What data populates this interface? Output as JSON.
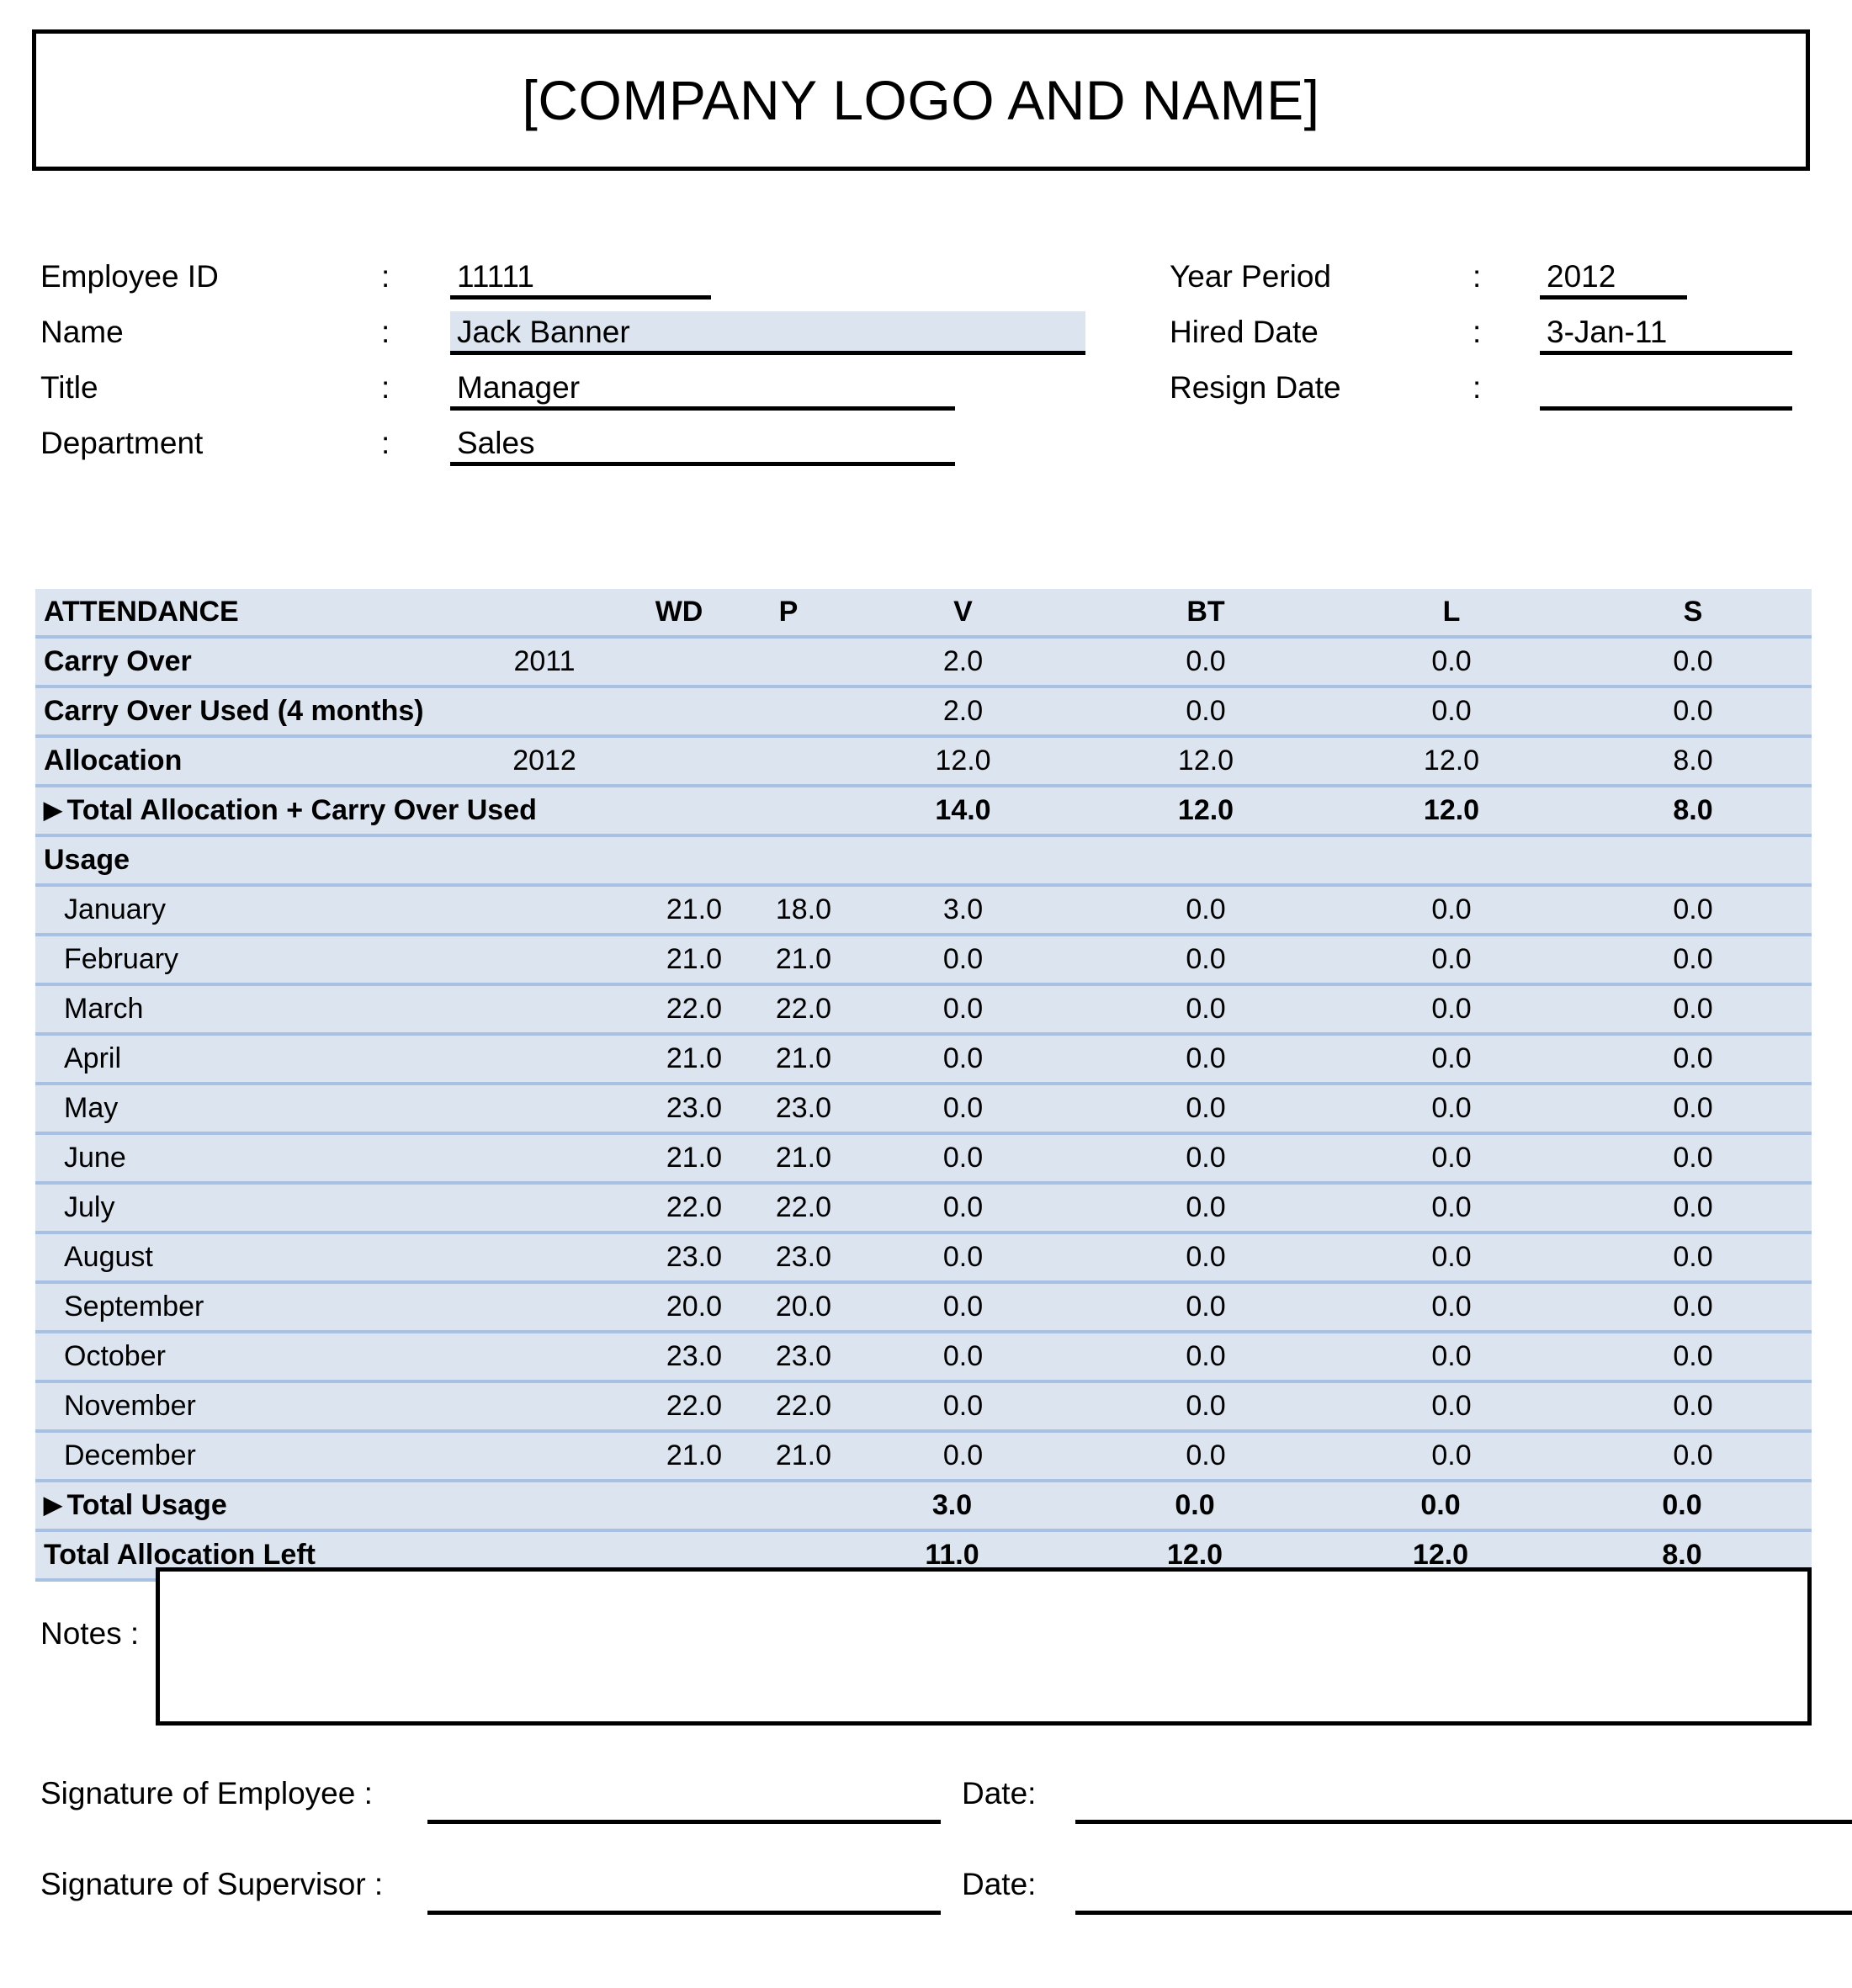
{
  "header": {
    "company_title": "[COMPANY LOGO AND NAME]"
  },
  "employee_info": {
    "colon": ":",
    "left_fields": [
      {
        "label": "Employee ID",
        "value": "11111"
      },
      {
        "label": "Name",
        "value": "Jack Banner"
      },
      {
        "label": "Title",
        "value": "Manager"
      },
      {
        "label": "Department",
        "value": "Sales"
      }
    ],
    "right_fields": [
      {
        "label": "Year Period",
        "value": "2012"
      },
      {
        "label": "Hired Date",
        "value": "3-Jan-11"
      },
      {
        "label": "Resign Date",
        "value": ""
      }
    ]
  },
  "attendance": {
    "columns": [
      "ATTENDANCE",
      "",
      "WD",
      "P",
      "V",
      "BT",
      "L",
      "S"
    ],
    "headers": {
      "label": "ATTENDANCE",
      "wd": "WD",
      "p": "P",
      "v": "V",
      "bt": "BT",
      "l": "L",
      "s": "S"
    },
    "carry_over": {
      "label": "Carry Over",
      "year": "2011",
      "wd": "",
      "p": "",
      "v": "2.0",
      "bt": "0.0",
      "l": "0.0",
      "s": "0.0"
    },
    "carry_over_used": {
      "label": "Carry Over Used (4 months)",
      "year": "",
      "wd": "",
      "p": "",
      "v": "2.0",
      "bt": "0.0",
      "l": "0.0",
      "s": "0.0"
    },
    "allocation": {
      "label": "Allocation",
      "year": "2012",
      "wd": "",
      "p": "",
      "v": "12.0",
      "bt": "12.0",
      "l": "12.0",
      "s": "8.0"
    },
    "total_allocation": {
      "marker": "▶",
      "label": "Total Allocation + Carry Over Used",
      "v": "14.0",
      "bt": "12.0",
      "l": "12.0",
      "s": "8.0"
    },
    "usage_heading": "Usage",
    "months": [
      {
        "month": "January",
        "wd": "21.0",
        "p": "18.0",
        "v": "3.0",
        "bt": "0.0",
        "l": "0.0",
        "s": "0.0"
      },
      {
        "month": "February",
        "wd": "21.0",
        "p": "21.0",
        "v": "0.0",
        "bt": "0.0",
        "l": "0.0",
        "s": "0.0"
      },
      {
        "month": "March",
        "wd": "22.0",
        "p": "22.0",
        "v": "0.0",
        "bt": "0.0",
        "l": "0.0",
        "s": "0.0"
      },
      {
        "month": "April",
        "wd": "21.0",
        "p": "21.0",
        "v": "0.0",
        "bt": "0.0",
        "l": "0.0",
        "s": "0.0"
      },
      {
        "month": "May",
        "wd": "23.0",
        "p": "23.0",
        "v": "0.0",
        "bt": "0.0",
        "l": "0.0",
        "s": "0.0"
      },
      {
        "month": "June",
        "wd": "21.0",
        "p": "21.0",
        "v": "0.0",
        "bt": "0.0",
        "l": "0.0",
        "s": "0.0"
      },
      {
        "month": "July",
        "wd": "22.0",
        "p": "22.0",
        "v": "0.0",
        "bt": "0.0",
        "l": "0.0",
        "s": "0.0"
      },
      {
        "month": "August",
        "wd": "23.0",
        "p": "23.0",
        "v": "0.0",
        "bt": "0.0",
        "l": "0.0",
        "s": "0.0"
      },
      {
        "month": "September",
        "wd": "20.0",
        "p": "20.0",
        "v": "0.0",
        "bt": "0.0",
        "l": "0.0",
        "s": "0.0"
      },
      {
        "month": "October",
        "wd": "23.0",
        "p": "23.0",
        "v": "0.0",
        "bt": "0.0",
        "l": "0.0",
        "s": "0.0"
      },
      {
        "month": "November",
        "wd": "22.0",
        "p": "22.0",
        "v": "0.0",
        "bt": "0.0",
        "l": "0.0",
        "s": "0.0"
      },
      {
        "month": "December",
        "wd": "21.0",
        "p": "21.0",
        "v": "0.0",
        "bt": "0.0",
        "l": "0.0",
        "s": "0.0"
      }
    ],
    "total_usage": {
      "marker": "▶",
      "label": "Total Usage",
      "v": "3.0",
      "bt": "0.0",
      "l": "0.0",
      "s": "0.0"
    },
    "total_allocation_left": {
      "label": "Total Allocation Left",
      "v": "11.0",
      "bt": "12.0",
      "l": "12.0",
      "s": "8.0"
    }
  },
  "notes": {
    "label": "Notes :",
    "value": ""
  },
  "signatures": {
    "employee_label": "Signature of Employee :",
    "supervisor_label": "Signature of Supervisor :",
    "date_label": "Date:",
    "employee_value": "",
    "employee_date": "",
    "supervisor_value": "",
    "supervisor_date": ""
  },
  "colors": {
    "header_blue": "#5A8FD5",
    "row_blue_light": "#DCE4EF",
    "row_blue_medium": "#92B7E3",
    "row_blue_dark": "#4F8AD4",
    "divider": "#A8C1E3",
    "highlight": "#DCE4EF"
  }
}
